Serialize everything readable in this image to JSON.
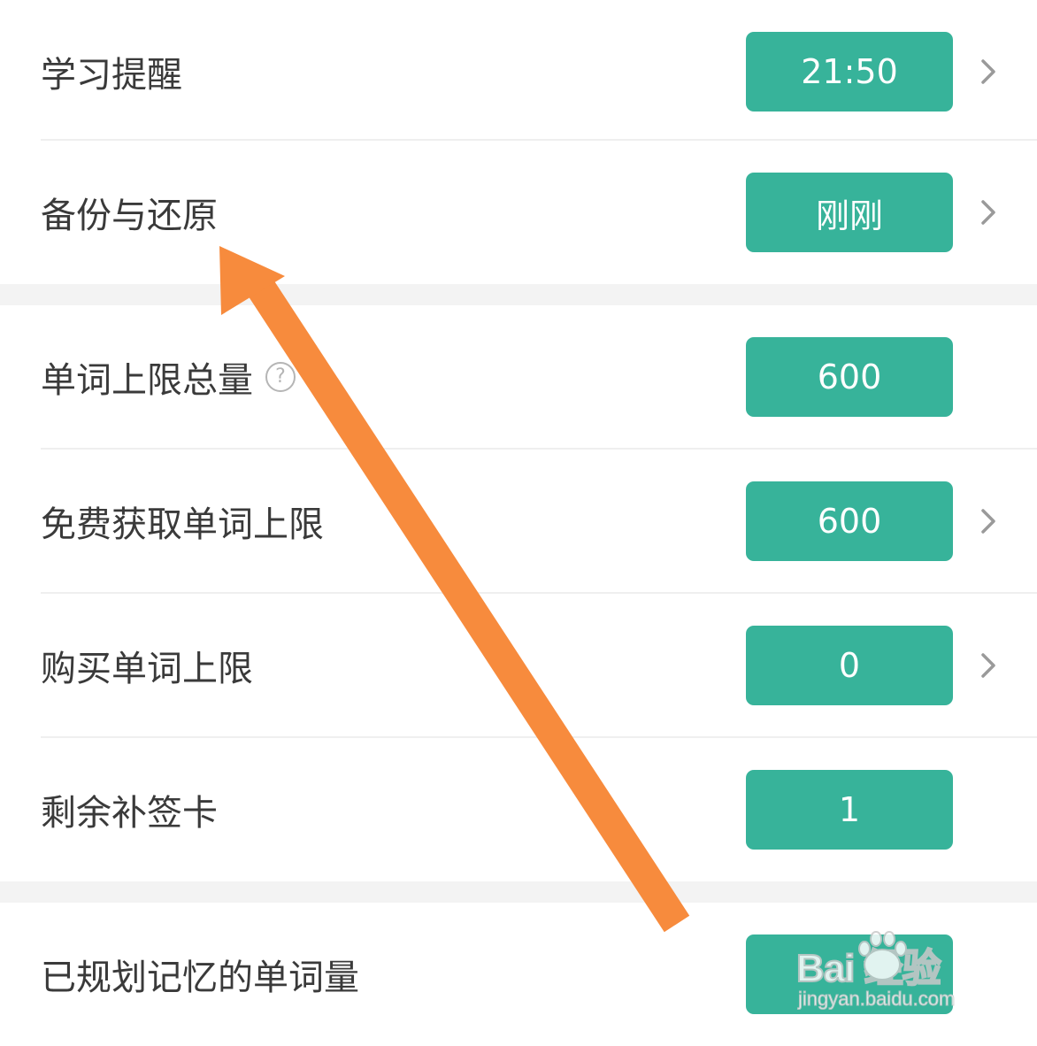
{
  "settings": {
    "group1": [
      {
        "label": "学习提醒",
        "value": "21:50",
        "has_chevron": true
      },
      {
        "label": "备份与还原",
        "value": "刚刚",
        "has_chevron": true
      }
    ],
    "group2": [
      {
        "label": "单词上限总量",
        "value": "600",
        "has_help": true,
        "help_glyph": "?",
        "has_chevron": false
      },
      {
        "label": "免费获取单词上限",
        "value": "600",
        "has_chevron": true
      },
      {
        "label": "购买单词上限",
        "value": "0",
        "has_chevron": true
      },
      {
        "label": "剩余补签卡",
        "value": "1",
        "has_chevron": false
      }
    ],
    "group3": [
      {
        "label": "已规划记忆的单词量",
        "value": "",
        "has_chevron": false
      }
    ]
  },
  "watermark": {
    "brand": "Bai  经验",
    "url": "jingyan.baidu.com"
  },
  "colors": {
    "accent": "#37b39a",
    "arrow": "#f78b3d",
    "label_text": "#3a3a3a",
    "chevron": "#9a9a9a"
  },
  "icons": {
    "chevron": "chevron-right-icon",
    "help": "help-circle-icon",
    "annotation": "annotation-arrow"
  }
}
